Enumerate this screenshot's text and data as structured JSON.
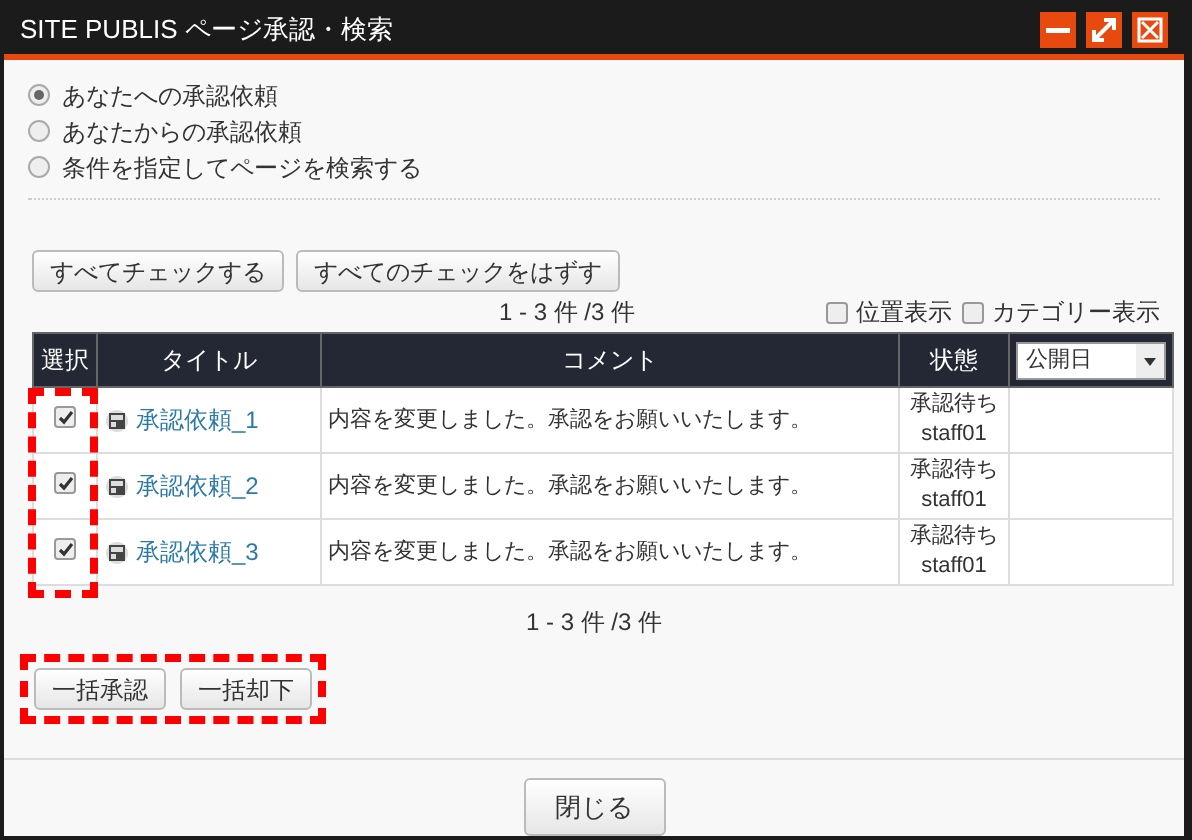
{
  "window": {
    "title": "SITE PUBLIS ページ承認・検索"
  },
  "radios": [
    {
      "label": "あなたへの承認依頼",
      "selected": true
    },
    {
      "label": "あなたからの承認依頼",
      "selected": false
    },
    {
      "label": "条件を指定してページを検索する",
      "selected": false
    }
  ],
  "top_buttons": [
    "すべてチェックする",
    "すべてのチェックをはずす"
  ],
  "count_top": "1 - 3 件 /3 件",
  "options": [
    {
      "label": "位置表示",
      "checked": false
    },
    {
      "label": "カテゴリー表示",
      "checked": false
    }
  ],
  "table": {
    "columns": [
      "選択",
      "タイトル",
      "コメント",
      "状態"
    ],
    "sort_select": {
      "value": "公開日"
    },
    "rows": [
      {
        "checked": true,
        "title": "承認依頼_1",
        "comment": "内容を変更しました。承認をお願いいたします。",
        "status": "承認待ち",
        "user": "staff01"
      },
      {
        "checked": true,
        "title": "承認依頼_2",
        "comment": "内容を変更しました。承認をお願いいたします。",
        "status": "承認待ち",
        "user": "staff01"
      },
      {
        "checked": true,
        "title": "承認依頼_3",
        "comment": "内容を変更しました。承認をお願いいたします。",
        "status": "承認待ち",
        "user": "staff01"
      }
    ]
  },
  "count_bottom": "1 - 3 件 /3 件",
  "bulk_buttons": [
    "一括承認",
    "一括却下"
  ],
  "close_button": "閉じる"
}
